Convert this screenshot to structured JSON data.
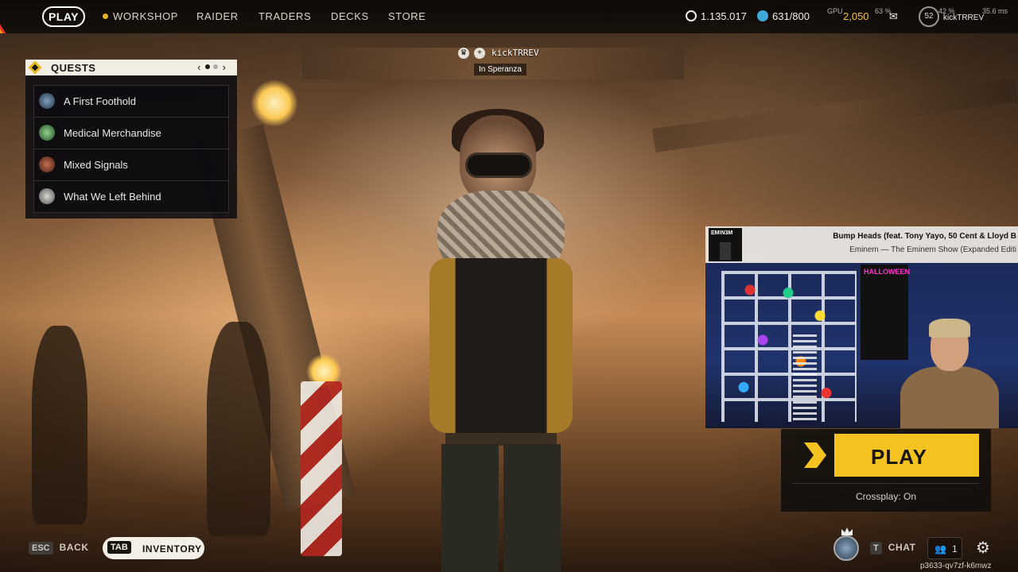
{
  "nav": {
    "play_label": "PLAY",
    "items": [
      "WORKSHOP",
      "RAIDER",
      "TRADERS",
      "DECKS",
      "STORE"
    ],
    "coins": "1.135.017",
    "capacity": "631/800",
    "currency": "2,050",
    "player_name": "kickTRREV",
    "level": "52",
    "perf_gpu": "GPU",
    "perf_values": [
      "63 %",
      "42 %",
      "35.6 ms"
    ]
  },
  "quests": {
    "title": "QUESTS",
    "prev": "‹",
    "next": "›",
    "page_index": 1,
    "page_count": 3,
    "items": [
      {
        "label": "A First Foothold"
      },
      {
        "label": "Medical Merchandise"
      },
      {
        "label": "Mixed Signals"
      },
      {
        "label": "What We Left Behind"
      }
    ]
  },
  "player_tag": {
    "name": "kickTRREV",
    "location": "In Speranza"
  },
  "music": {
    "album_text": "EMIN3M",
    "song": "Bump Heads (feat. Tony Yayo, 50 Cent & Lloyd B",
    "artist": "Eminem — The Eminem Show (Expanded Editi"
  },
  "webcam": {
    "poster_text": "HALLOWEEN"
  },
  "play_panel": {
    "play_label": "PLAY",
    "crossplay": "Crossplay: On"
  },
  "bottom": {
    "esc_key": "ESC",
    "back_label": "BACK",
    "tab_key": "TAB",
    "inventory_label": "INVENTORY",
    "chat_key": "T",
    "chat_label": "CHAT",
    "friends_count": "1",
    "session_id": "p3633-qv7zf-k6mwz"
  },
  "colors": {
    "accent_yellow": "#f4c320",
    "panel_dark": "#100e12"
  }
}
